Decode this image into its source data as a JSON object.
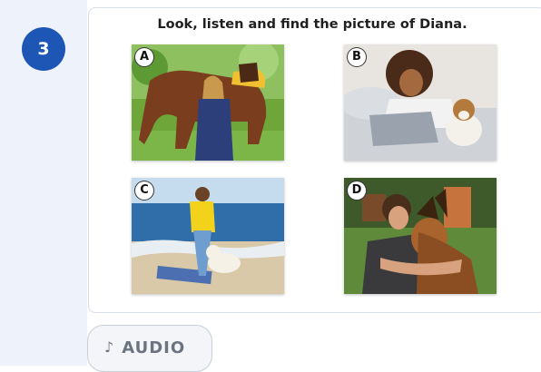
{
  "question": {
    "number": "3"
  },
  "instruction": "Look, listen and find the picture of Diana.",
  "pictures": [
    {
      "label": "A"
    },
    {
      "label": "B"
    },
    {
      "label": "C"
    },
    {
      "label": "D"
    }
  ],
  "audio_button": {
    "icon": "music-note-icon",
    "glyph": "♪",
    "label": "AUDIO"
  },
  "colors": {
    "badge": "#1d56b5",
    "rail": "#eef2fa",
    "card_border": "#d8deea"
  }
}
